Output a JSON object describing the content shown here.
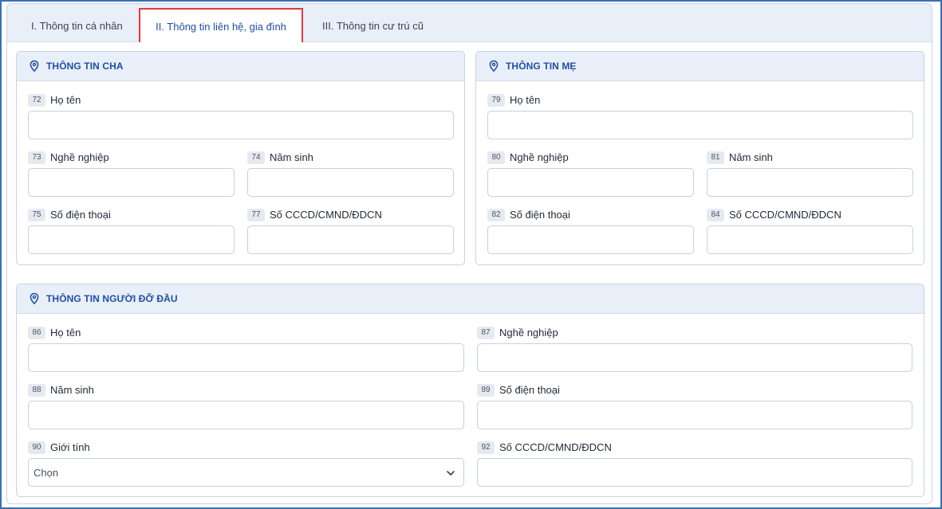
{
  "tabs": [
    {
      "label": "I. Thông tin cá nhân"
    },
    {
      "label": "II. Thông tin liên hệ, gia đình"
    },
    {
      "label": "III. Thông tin cư trú cũ"
    }
  ],
  "father": {
    "title": "THÔNG TIN CHA",
    "fields": [
      {
        "num": "72",
        "label": "Họ tên",
        "value": ""
      },
      {
        "num": "73",
        "label": "Nghề nghiệp",
        "value": ""
      },
      {
        "num": "74",
        "label": "Năm sinh",
        "value": ""
      },
      {
        "num": "75",
        "label": "Số điện thoại",
        "value": ""
      },
      {
        "num": "77",
        "label": "Số CCCD/CMND/ĐDCN",
        "value": ""
      }
    ]
  },
  "mother": {
    "title": "THÔNG TIN MẸ",
    "fields": [
      {
        "num": "79",
        "label": "Họ tên",
        "value": ""
      },
      {
        "num": "80",
        "label": "Nghề nghiệp",
        "value": ""
      },
      {
        "num": "81",
        "label": "Năm sinh",
        "value": ""
      },
      {
        "num": "82",
        "label": "Số điện thoại",
        "value": ""
      },
      {
        "num": "84",
        "label": "Số CCCD/CMND/ĐDCN",
        "value": ""
      }
    ]
  },
  "guardian": {
    "title": "THÔNG TIN NGƯỜI ĐỠ ĐẦU",
    "fields": [
      {
        "num": "86",
        "label": "Họ tên",
        "value": ""
      },
      {
        "num": "87",
        "label": "Nghề nghiệp",
        "value": ""
      },
      {
        "num": "88",
        "label": "Năm sinh",
        "value": ""
      },
      {
        "num": "89",
        "label": "Số điện thoại",
        "value": ""
      },
      {
        "num": "90",
        "label": "Giới tính",
        "value": "Chọn"
      },
      {
        "num": "92",
        "label": "Số CCCD/CMND/ĐDCN",
        "value": ""
      }
    ]
  },
  "icons": {
    "section": "location-pin-icon",
    "dropdown": "chevron-down-icon"
  },
  "colors": {
    "accent": "#1f4fa3",
    "header_bg": "#e9eff9",
    "active_tab_border": "#e03a3a"
  }
}
